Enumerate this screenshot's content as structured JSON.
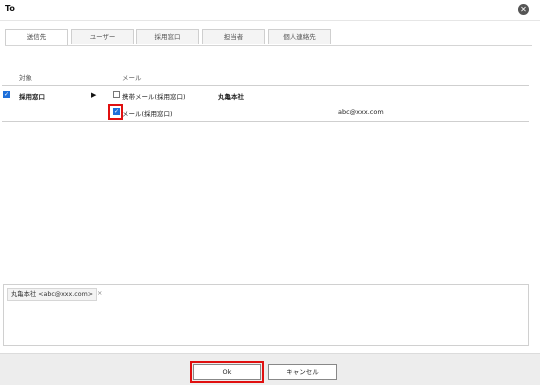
{
  "window": {
    "title": "To"
  },
  "tabs": [
    "送信先",
    "ユーザー",
    "採用窓口",
    "担当者",
    "個人連絡先"
  ],
  "table": {
    "col_target": "対象",
    "col_mail": "メール",
    "group": {
      "name": "採用窓口",
      "checked": true,
      "org": "丸亀本社"
    },
    "rows": [
      {
        "label": "携帯メール(採用窓口)",
        "checked": false,
        "email": ""
      },
      {
        "label": "メール(採用窓口)",
        "checked": true,
        "email": "abc@xxx.com"
      }
    ]
  },
  "recipients": [
    {
      "label": "丸亀本社 <abc@xxx.com>"
    }
  ],
  "buttons": {
    "ok": "Ok",
    "cancel": "キャンセル"
  },
  "colors": {
    "check": "#1e6fd9",
    "highlight": "#e01010"
  }
}
